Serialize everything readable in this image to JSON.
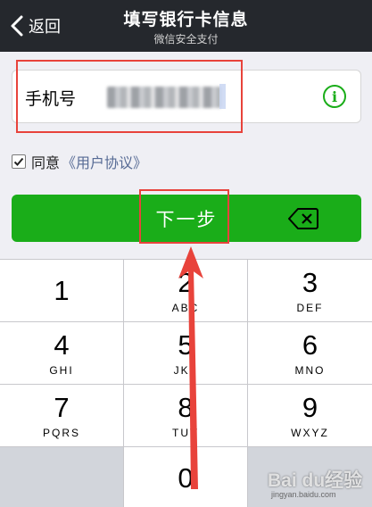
{
  "nav": {
    "back_label": "返回",
    "title": "填写银行卡信息",
    "subtitle": "微信安全支付"
  },
  "form": {
    "phone_label": "手机号",
    "phone_value": "••••••••••",
    "info_icon_glyph": "i",
    "agree_label": "同意",
    "agreement_link": "《用户协议》",
    "agree_checked": true,
    "next_label": "下一步"
  },
  "keypad": {
    "keys": [
      {
        "digit": "1",
        "letters": ""
      },
      {
        "digit": "2",
        "letters": "ABC"
      },
      {
        "digit": "3",
        "letters": "DEF"
      },
      {
        "digit": "4",
        "letters": "GHI"
      },
      {
        "digit": "5",
        "letters": "JKL"
      },
      {
        "digit": "6",
        "letters": "MNO"
      },
      {
        "digit": "7",
        "letters": "PQRS"
      },
      {
        "digit": "8",
        "letters": "TUV"
      },
      {
        "digit": "9",
        "letters": "WXYZ"
      },
      {
        "digit": "0",
        "letters": ""
      }
    ],
    "delete_icon": "backspace-icon"
  },
  "watermark": {
    "logo": "Bai du经验",
    "sub": "jingyan.baidu.com"
  },
  "colors": {
    "navbar": "#25282d",
    "primary_green": "#1aad19",
    "link_blue": "#576b95",
    "annotation_red": "#e8433b"
  }
}
